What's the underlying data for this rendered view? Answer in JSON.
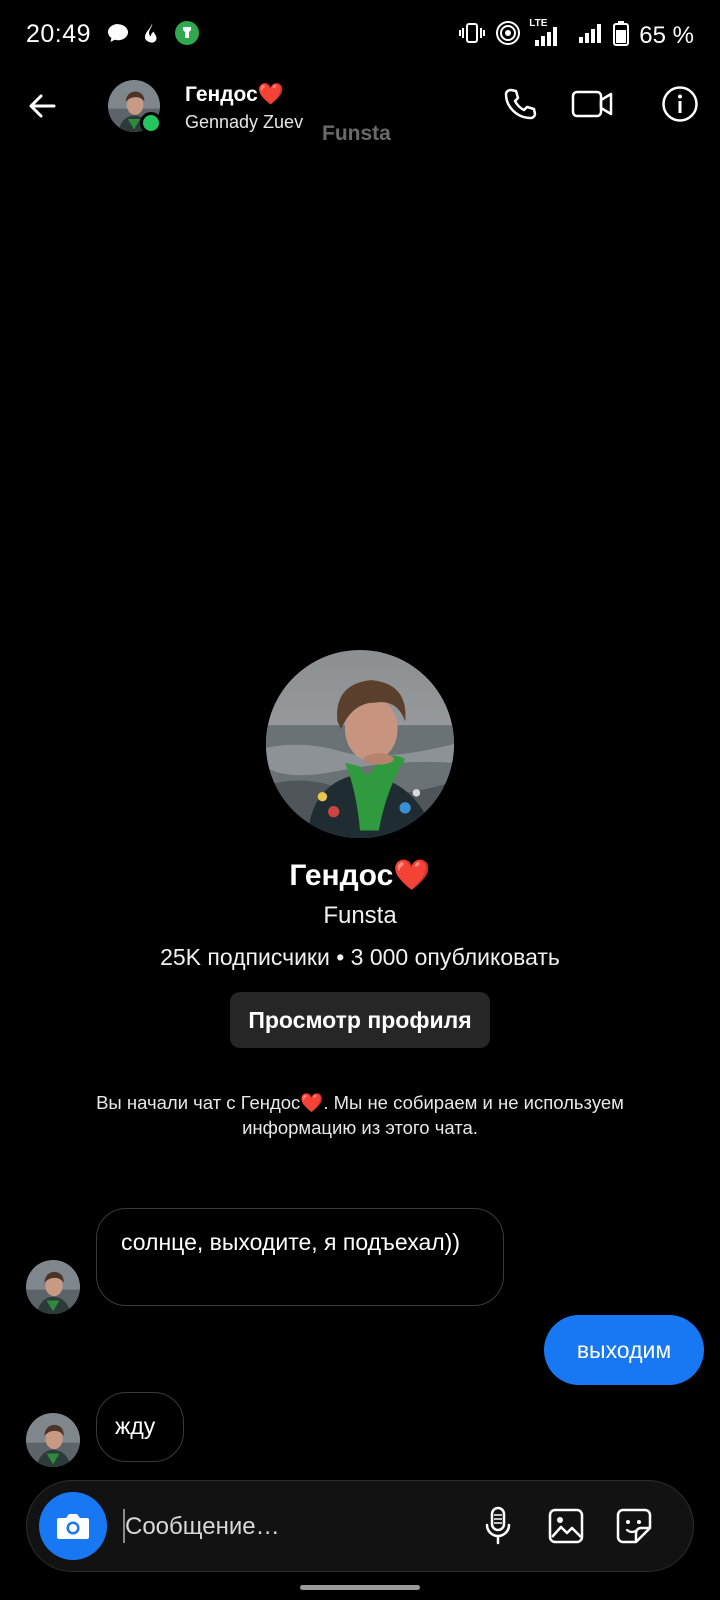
{
  "status_bar": {
    "time": "20:49",
    "battery_percent": "65 %",
    "network_label": "LTE",
    "icons": [
      "chat-bubble-icon",
      "flame-icon",
      "app-badge-icon",
      "vibrate-icon",
      "hotspot-icon",
      "signal-icon",
      "signal-icon",
      "battery-icon"
    ]
  },
  "header": {
    "display_name": "Гендос❤️",
    "username": "Gennady Zuev",
    "faded_label": "Funsta",
    "online": true
  },
  "profile": {
    "name": "Гендос❤️",
    "subtitle": "Funsta",
    "stats": "25K подписчики • 3 000 опубликовать",
    "view_button": "Просмотр профиля"
  },
  "notice": "Вы начали чат с Гендос❤️. Мы не собираем и не используем информацию из этого чата.",
  "messages": [
    {
      "direction": "in",
      "text": "солнце, выходите, я подъехал))"
    },
    {
      "direction": "out",
      "text": "выходим"
    },
    {
      "direction": "in",
      "text": "жду"
    }
  ],
  "composer": {
    "placeholder": "Сообщение…"
  },
  "colors": {
    "accent": "#1877f2",
    "online": "#24c45e",
    "background": "#000000"
  }
}
